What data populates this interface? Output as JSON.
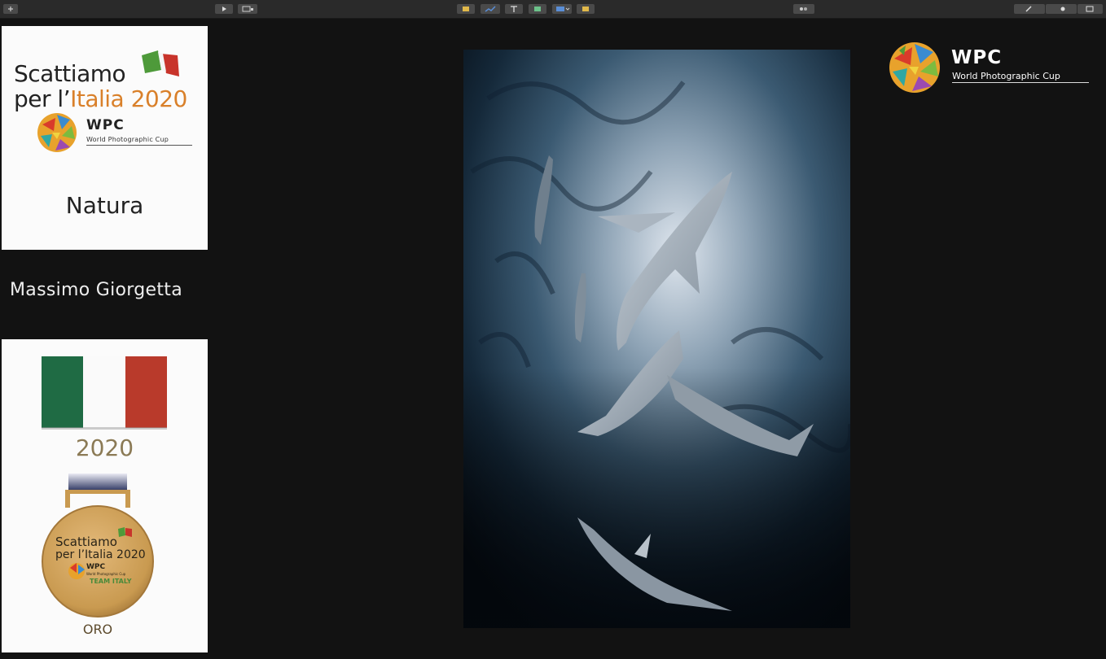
{
  "toolbar": {
    "buttons": [
      "add",
      "play",
      "present",
      "table",
      "chart",
      "text",
      "shape",
      "media",
      "comment",
      "collaborate",
      "format",
      "animate",
      "document"
    ]
  },
  "category_card": {
    "logo_line1": "Scattiamo",
    "logo_line2_a": "per l’",
    "logo_line2_b": "Italia 2020",
    "wpc": "WPC",
    "wpc_sub": "World Photographic Cup",
    "category": "Natura"
  },
  "photographer": {
    "name": "Massimo Giorgetta"
  },
  "award_card": {
    "year": "2020",
    "medal_line1": "Scattiamo",
    "medal_line2": "per l’Italia 2020",
    "medal_wpc": "WPC",
    "medal_wpc_sub": "World Photographic Cup",
    "medal_team": "TEAM ITALY",
    "medal_level": "ORO"
  },
  "brand": {
    "wpc": "WPC",
    "sub": "World Photographic Cup"
  },
  "colors": {
    "flag_green": "#1f6b44",
    "flag_white": "#fafafa",
    "flag_red": "#b93a2b",
    "gold": "#c99a50",
    "orange": "#d9802a"
  }
}
